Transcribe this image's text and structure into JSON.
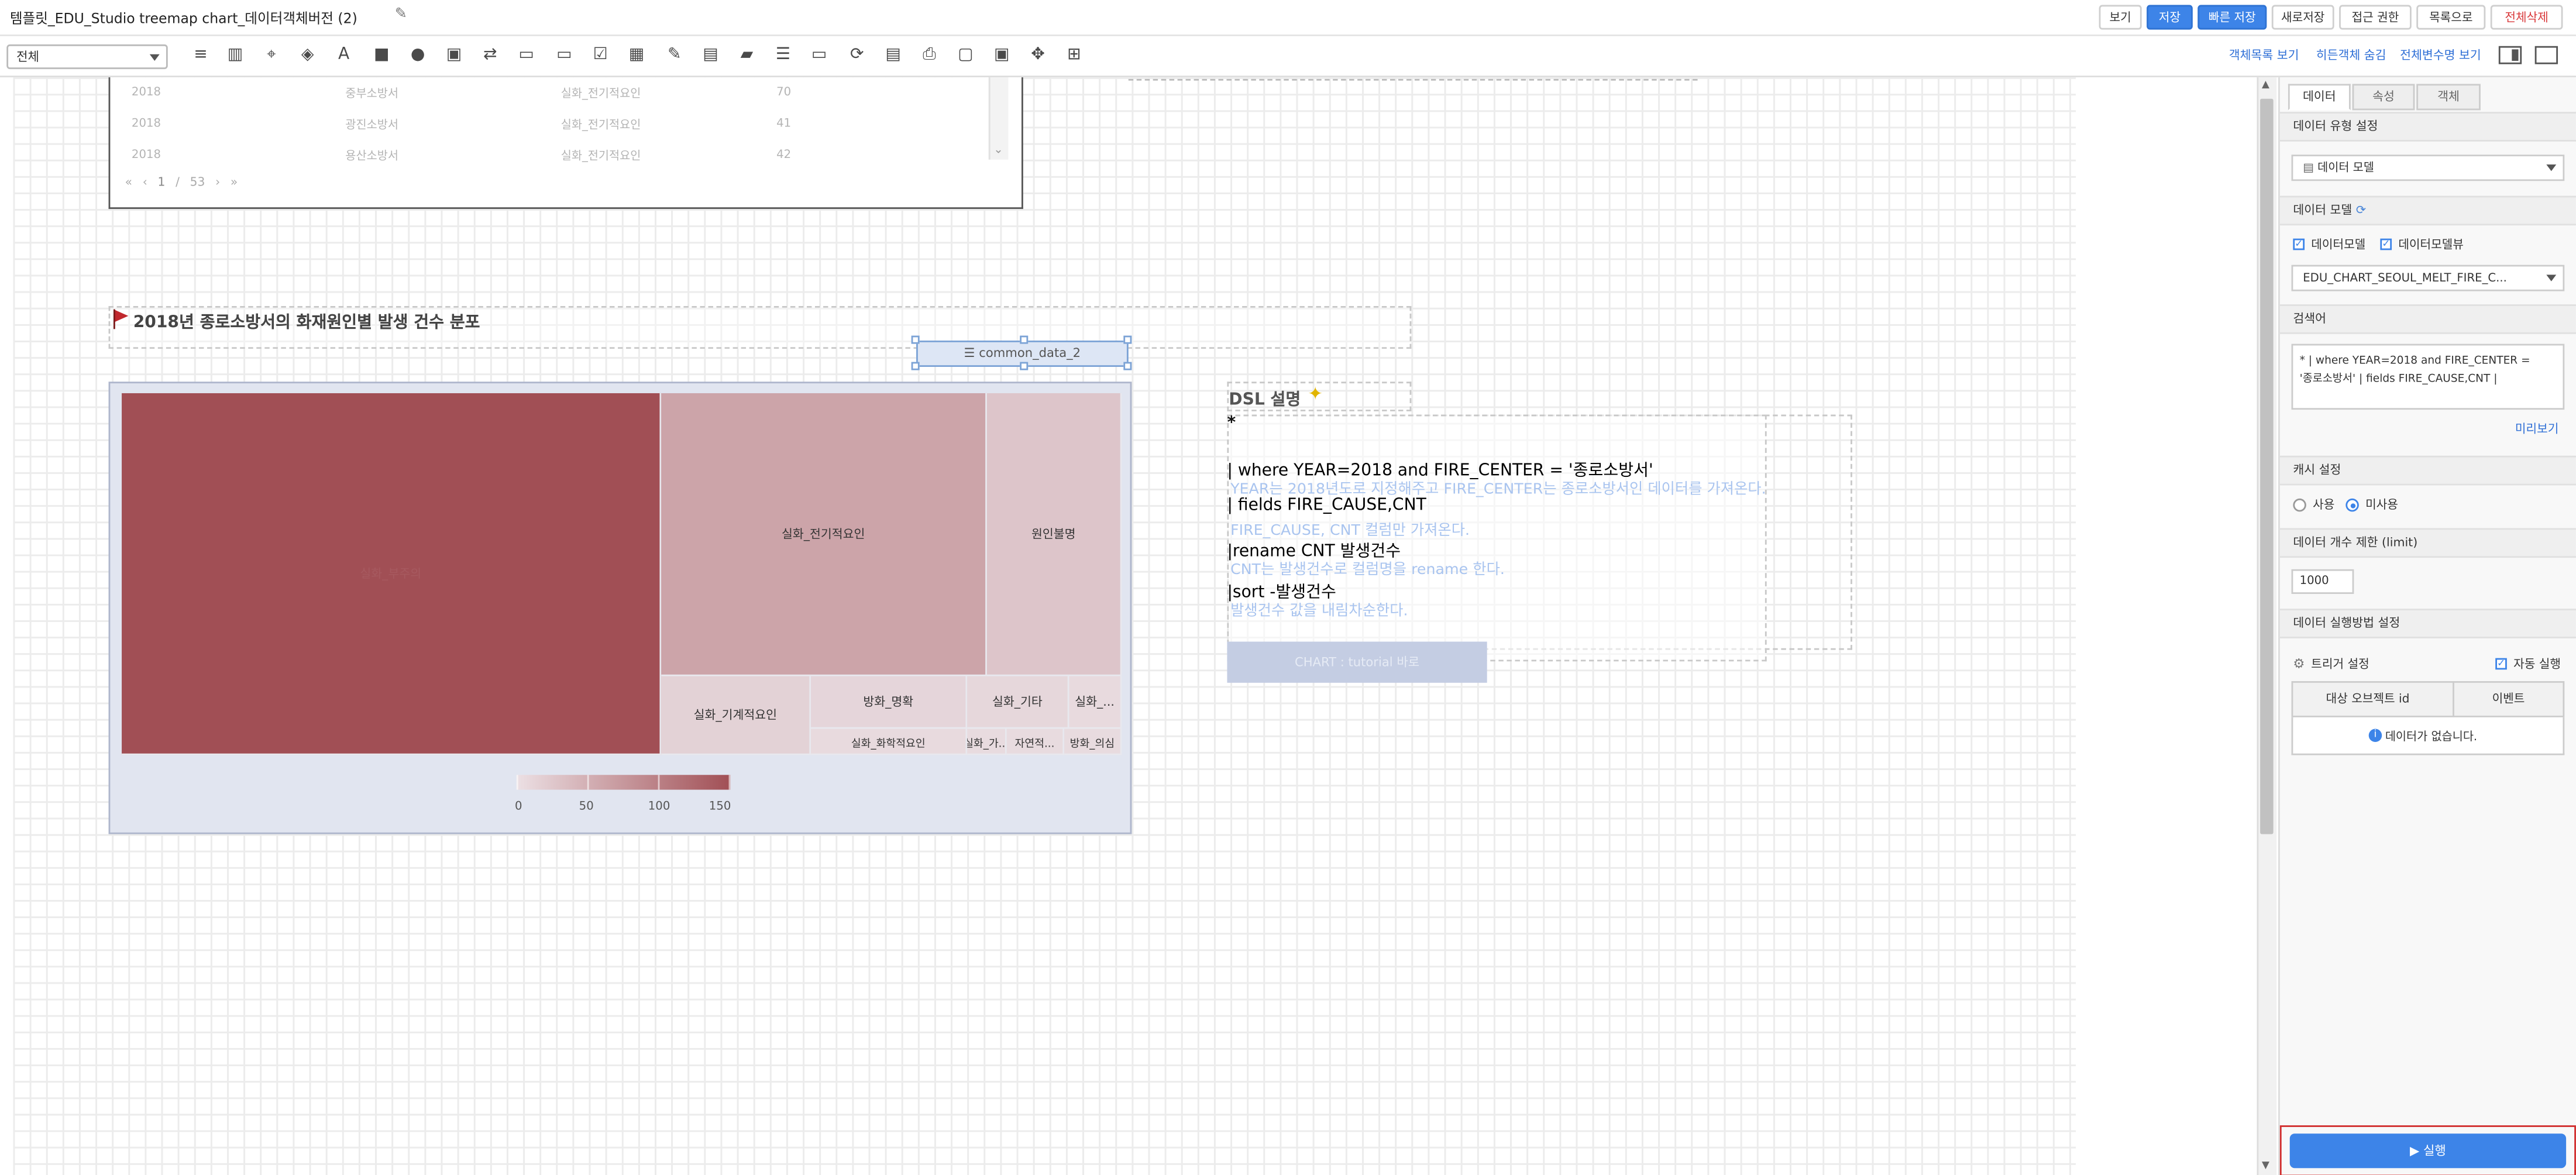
{
  "header": {
    "title": "템플릿_EDU_Studio treemap chart_데이터객체버전 (2)",
    "buttons": [
      "보기",
      "저장",
      "빠른 저장",
      "새로저장",
      "접근 권한",
      "목록으로",
      "전체삭제"
    ]
  },
  "toolbar": {
    "select_value": "전체",
    "links": [
      "객체목록 보기",
      "히든객체 숨김",
      "전체변수명 보기"
    ]
  },
  "table": {
    "rows": [
      [
        "2018",
        "중부소방서",
        "실화_전기적요인",
        "70"
      ],
      [
        "2018",
        "광진소방서",
        "실화_전기적요인",
        "41"
      ],
      [
        "2018",
        "용산소방서",
        "실화_전기적요인",
        "42"
      ]
    ],
    "pager": {
      "first": "«",
      "prev": "‹",
      "page": "1",
      "sep": "/",
      "total": "53",
      "next": "›",
      "last": "»"
    }
  },
  "chart_heading": "2018년 종로소방서의 화재원인별 발생 건수 분포",
  "chart_object_label": "common_data_2",
  "chart_data": {
    "type": "treemap",
    "title": "2018년 종로소방서의 화재원인별 발생 건수 분포",
    "cells": [
      {
        "label": "실화_부주의",
        "value": 150
      },
      {
        "label": "실화_전기적요인",
        "value": 60
      },
      {
        "label": "원인불명",
        "value": 25
      },
      {
        "label": "실화_기계적요인",
        "value": 12
      },
      {
        "label": "방화_명확",
        "value": 8
      },
      {
        "label": "실화_기타",
        "value": 6
      },
      {
        "label": "실화_...",
        "value": 3
      },
      {
        "label": "실화_화학적요인",
        "value": 3
      },
      {
        "label": "실화_가...",
        "value": 2
      },
      {
        "label": "자연적...",
        "value": 2
      },
      {
        "label": "방화_의심",
        "value": 2
      }
    ],
    "scale_ticks": [
      "0",
      "50",
      "100",
      "150"
    ],
    "color_range": [
      "#e9dde1",
      "#a14f55"
    ]
  },
  "dsl": {
    "title": "DSL 설명",
    "lines": [
      "*",
      "| where YEAR=2018 and FIRE_CENTER = '종로소방서'",
      "| fields FIRE_CAUSE,CNT",
      "|rename CNT 발생건수",
      "|sort -발생건수"
    ],
    "notes": [
      "YEAR는 2018년도로 지정해주고 FIRE_CENTER는 종로소방서인 데이터를 가져온다.",
      "FIRE_CAUSE, CNT 컬럼만 가져온다.",
      "CNT는 발생건수로 컬럼명을 rename 한다.",
      "발생건수 값을 내림차순한다."
    ],
    "button": "CHART : tutorial 바로"
  },
  "sidebar": {
    "tabs": [
      "데이터",
      "속성",
      "객체"
    ],
    "data_type_label": "데이터 유형 설정",
    "data_type_value": "데이터 모델",
    "data_model_label": "데이터 모델",
    "chk_model": "데이터모델",
    "chk_view": "데이터모델뷰",
    "model_value": "EDU_CHART_SEOUL_MELT_FIRE_C...",
    "search_label": "검색어",
    "query": "* | where YEAR=2018 and FIRE_CENTER = '종로소방서' | fields FIRE_CAUSE,CNT |",
    "preview_link": "미리보기",
    "cache_label": "캐시 설정",
    "cache_use": "사용",
    "cache_nouse": "미사용",
    "limit_label": "데이터 개수 제한 (limit)",
    "limit_value": "1000",
    "exec_label": "데이터 실행방법 설정",
    "trigger_label": "트리거 설정",
    "auto_label": "자동 실행",
    "col_id": "대상 오브젝트 id",
    "col_event": "이벤트",
    "empty": "데이터가 없습니다.",
    "run_button": "▶ 실행"
  }
}
